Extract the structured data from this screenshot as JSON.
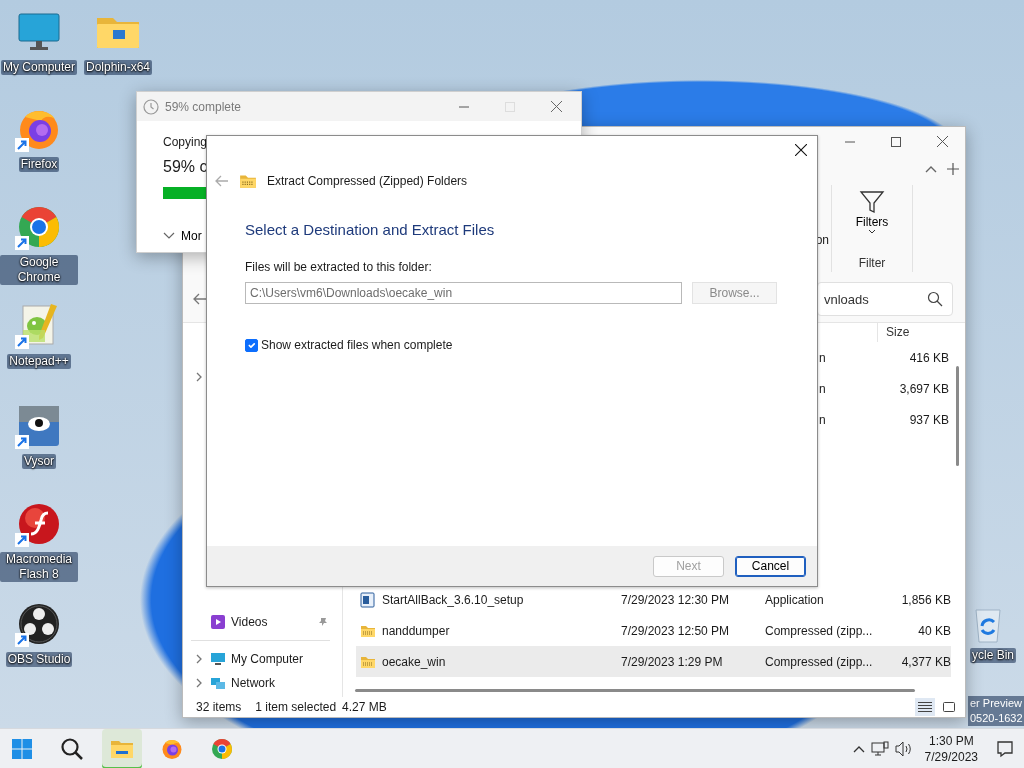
{
  "desktop_icons": [
    {
      "label": "My Computer",
      "kind": "computer",
      "shortcut": false
    },
    {
      "label": "Dolphin-x64",
      "kind": "folder",
      "shortcut": false
    },
    {
      "label": "Firefox",
      "kind": "firefox",
      "shortcut": true
    },
    {
      "label": "Google Chrome",
      "kind": "chrome",
      "shortcut": true
    },
    {
      "label": "Notepad++",
      "kind": "notepad",
      "shortcut": true
    },
    {
      "label": "Vysor",
      "kind": "vysor",
      "shortcut": true
    },
    {
      "label": "Macromedia Flash 8",
      "kind": "flash",
      "shortcut": true
    },
    {
      "label": "OBS Studio",
      "kind": "obs",
      "shortcut": true
    }
  ],
  "recycle_bin": {
    "label": "ycle Bin"
  },
  "desktop_texts": [
    "er Preview",
    "0520-1632"
  ],
  "copy_window": {
    "title": "59% complete",
    "status": "Copying",
    "percent": "59% c",
    "level": 0.59,
    "details": "Mor"
  },
  "explorer": {
    "ribbon": {
      "partial_label": "on",
      "filters": "Filters",
      "group": "Filter"
    },
    "search": {
      "placeholder": "vnloads"
    },
    "size_header": "Size",
    "top_rows": [
      {
        "type": "n",
        "size": "416 KB"
      },
      {
        "type": "n",
        "size": "3,697 KB"
      },
      {
        "type": "n",
        "size": "937 KB"
      }
    ],
    "nav": [
      {
        "label": "Videos",
        "kind": "videos",
        "pinned": true,
        "expandable": false
      },
      {
        "label": "My Computer",
        "kind": "computer",
        "pinned": false,
        "expandable": true
      },
      {
        "label": "Network",
        "kind": "network",
        "pinned": false,
        "expandable": true
      }
    ],
    "files": [
      {
        "name": "StartAllBack_3.6.10_setup",
        "date": "7/29/2023 12:30 PM",
        "type": "Application",
        "size": "1,856 KB",
        "kind": "app",
        "selected": false
      },
      {
        "name": "nanddumper",
        "date": "7/29/2023 12:50 PM",
        "type": "Compressed (zipp...",
        "size": "40 KB",
        "kind": "zip",
        "selected": false
      },
      {
        "name": "oecake_win",
        "date": "7/29/2023 1:29 PM",
        "type": "Compressed (zipp...",
        "size": "4,377 KB",
        "kind": "zip",
        "selected": true
      }
    ],
    "status": {
      "items": "32 items",
      "selection": "1 item selected",
      "size": "4.27 MB"
    },
    "view_buttons": [
      {
        "kind": "details",
        "selected": true
      },
      {
        "kind": "tiles",
        "selected": false
      }
    ]
  },
  "extract_dialog": {
    "title": "Extract Compressed (Zipped) Folders",
    "heading": "Select a Destination and Extract Files",
    "folder_label": "Files will be extracted to this folder:",
    "path": {
      "value": "C:\\Users\\vm6\\Downloads\\oecake_win",
      "disabled": true
    },
    "browse": {
      "label": "Browse...",
      "disabled": true
    },
    "show_files": {
      "label": "Show extracted files when complete",
      "checked": true
    },
    "buttons": [
      {
        "label": "Next",
        "disabled": true,
        "default": false
      },
      {
        "label": "Cancel",
        "disabled": false,
        "default": true
      }
    ]
  },
  "taskbar": {
    "apps": [
      {
        "kind": "start",
        "active": false
      },
      {
        "kind": "search",
        "active": false
      },
      {
        "kind": "explorer",
        "active": true
      },
      {
        "kind": "firefox",
        "active": false
      },
      {
        "kind": "chrome",
        "active": false
      }
    ],
    "time": "1:30 PM",
    "date": "7/29/2023"
  }
}
